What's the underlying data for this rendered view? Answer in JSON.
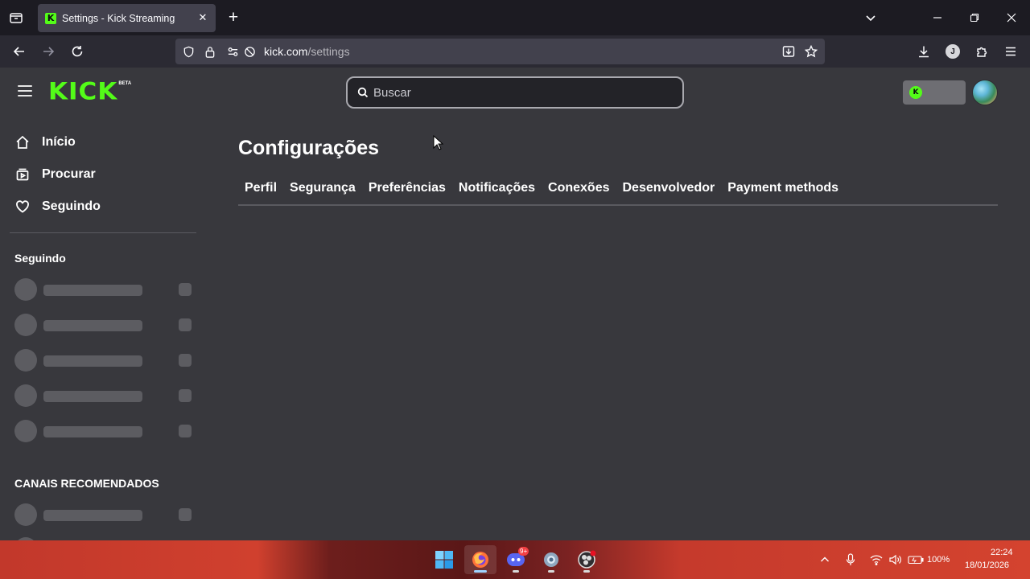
{
  "browser": {
    "tab": {
      "title": "Settings - Kick Streaming",
      "favicon": "K"
    },
    "url": {
      "host": "kick.com",
      "path": "/settings"
    },
    "account_initial": "J"
  },
  "header": {
    "logo_text": "KICK",
    "logo_badge": "BETA",
    "search_placeholder": "Buscar",
    "wallet_badge": "K"
  },
  "sidebar": {
    "nav": [
      {
        "label": "Início",
        "icon": "home-icon"
      },
      {
        "label": "Procurar",
        "icon": "browse-icon"
      },
      {
        "label": "Seguindo",
        "icon": "heart-icon"
      }
    ],
    "following_heading": "Seguindo",
    "recommended_heading": "CANAIS RECOMENDADOS"
  },
  "main": {
    "title": "Configurações",
    "tabs": [
      {
        "label": "Perfil"
      },
      {
        "label": "Segurança"
      },
      {
        "label": "Preferências"
      },
      {
        "label": "Notificações"
      },
      {
        "label": "Conexões"
      },
      {
        "label": "Desenvolvedor"
      },
      {
        "label": "Payment methods"
      }
    ]
  },
  "taskbar": {
    "battery": "100%",
    "time": "22:24",
    "date": "18/01/2026",
    "discord_badge": "9+"
  },
  "colors": {
    "brand": "#53fc18",
    "page_bg": "#38383d",
    "browser_chrome": "#1c1b22"
  }
}
